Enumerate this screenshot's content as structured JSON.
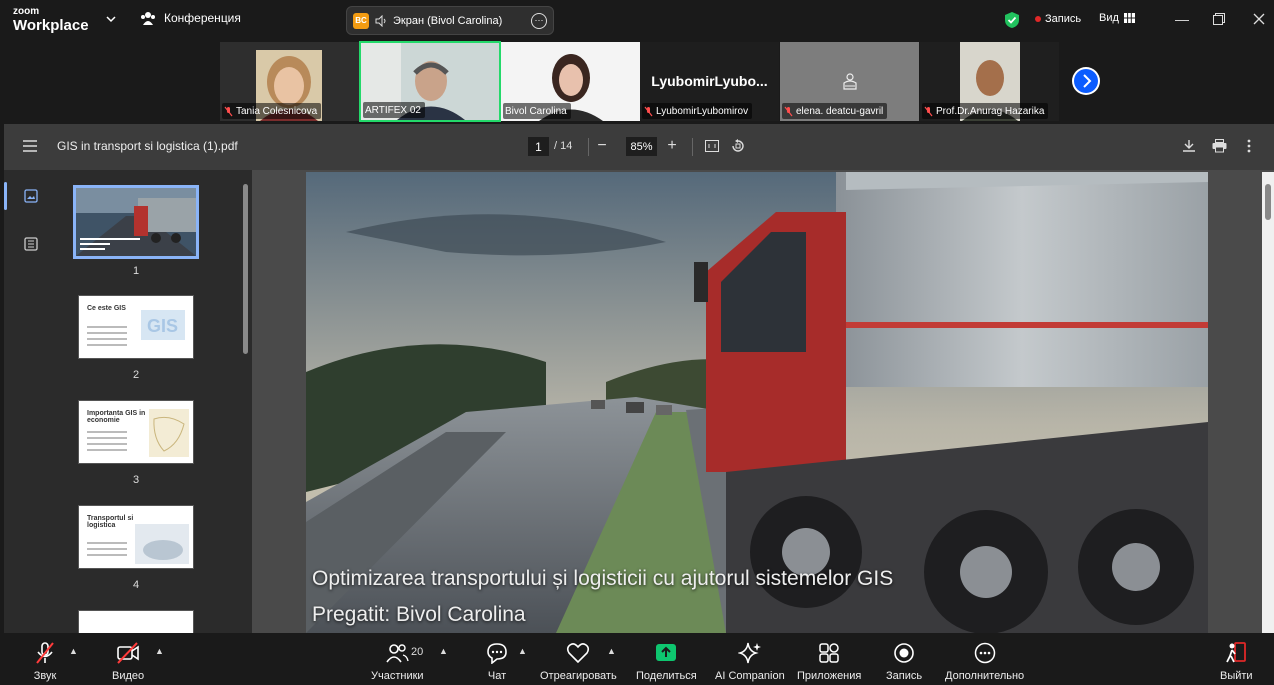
{
  "app": {
    "logo_small": "zoom",
    "logo_big": "Workplace",
    "meeting_label": "Конференция",
    "share_badge": "BC",
    "share_label": "Экран (Bivol Carolina)",
    "recording_label": "Запись",
    "view_label": "Вид"
  },
  "participants": [
    {
      "name": "Tania Colesnicova",
      "muted": true
    },
    {
      "name": "ARTIFEX 02",
      "muted": false,
      "active": true
    },
    {
      "name": "Bivol Carolina",
      "muted": false
    },
    {
      "name": "LyubomirLyubomirov",
      "big_name": "LyubomirLyubo...",
      "muted": true
    },
    {
      "name": "elena. deatcu-gavril",
      "muted": true
    },
    {
      "name": "Prof.Dr.Anurag Hazarika",
      "muted": true
    }
  ],
  "pdf": {
    "title": "GIS in transport si logistica (1).pdf",
    "current_page": "1",
    "total_pages": "/ 14",
    "zoom": "85%"
  },
  "thumbnails": [
    {
      "num": "1",
      "title": ""
    },
    {
      "num": "2",
      "title": "Ce este GIS"
    },
    {
      "num": "3",
      "title": "Importanta GIS in economie"
    },
    {
      "num": "4",
      "title": "Transportul si logistica"
    }
  ],
  "slide": {
    "line1": "Optimizarea transportului și logisticii cu ajutorul sistemelor GIS",
    "line2": "Pregatit: Bivol Carolina"
  },
  "toolbar": {
    "audio": "Звук",
    "video": "Видео",
    "participants": "Участники",
    "participants_count": "20",
    "chat": "Чат",
    "react": "Отреагировать",
    "share": "Поделиться",
    "ai": "AI Companion",
    "apps": "Приложения",
    "record": "Запись",
    "more": "Дополнительно",
    "leave": "Выйти"
  },
  "colors": {
    "active_speaker": "#23d96a",
    "share_green": "#0ec66f",
    "leave_red": "#e02828",
    "record_red": "#e02828",
    "shield_green": "#21c25e",
    "next_blue": "#0b5cff"
  }
}
